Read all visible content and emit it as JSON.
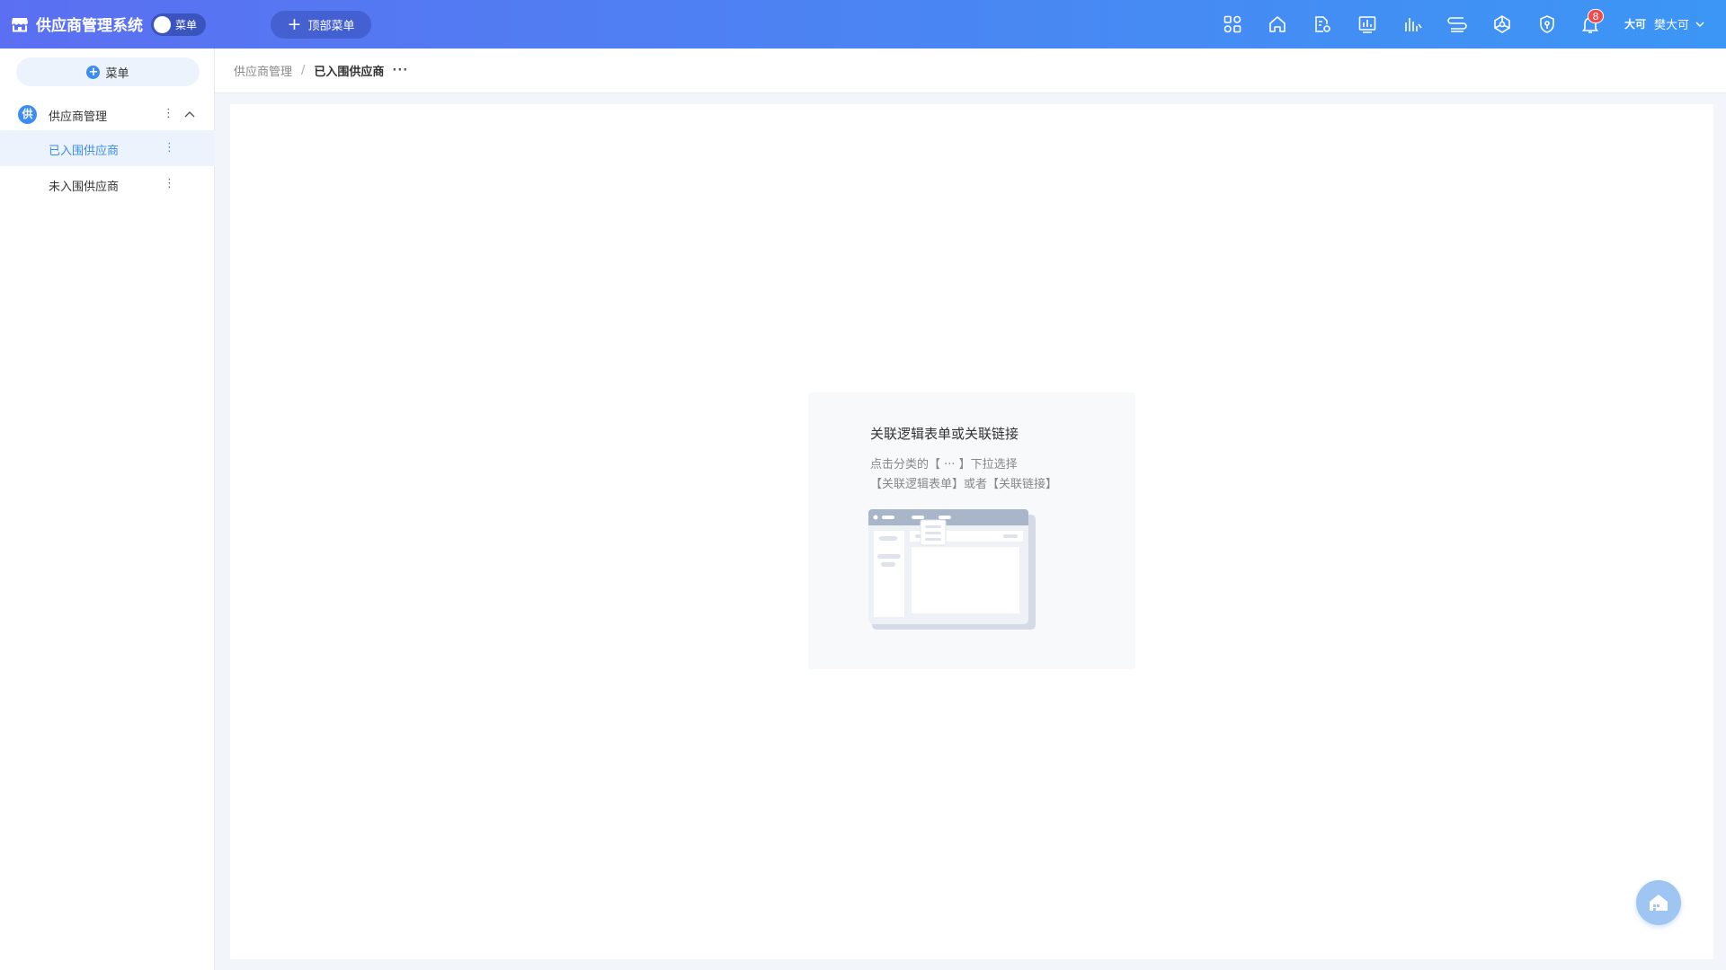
{
  "header": {
    "app_title": "供应商管理系统",
    "menu_toggle_label": "菜单",
    "top_menu_label": "顶部菜单",
    "notification_count": "8",
    "user_avatar_text": "大可",
    "user_name": "樊大可",
    "icons": [
      "apps-icon",
      "home-icon",
      "file-settings-icon",
      "dashboard-icon",
      "bar-chart-icon",
      "workflow-icon",
      "network-icon",
      "shield-icon",
      "bell-icon"
    ]
  },
  "sidebar": {
    "add_menu_label": "菜单",
    "group": {
      "icon_text": "供",
      "label": "供应商管理"
    },
    "items": [
      {
        "label": "已入围供应商",
        "active": true
      },
      {
        "label": "未入围供应商",
        "active": false
      }
    ]
  },
  "breadcrumb": {
    "parent": "供应商管理",
    "separator": "/",
    "current": "已入围供应商",
    "more": "···"
  },
  "main": {
    "empty_title": "关联逻辑表单或关联链接",
    "empty_desc_line1": "点击分类的【 ··· 】下拉选择",
    "empty_desc_line2": "【关联逻辑表单】或者【关联链接】"
  },
  "colors": {
    "header_gradient_start": "#5b6ff2",
    "header_gradient_end": "#3c96f5",
    "accent": "#3b8cf3",
    "active_bg": "#ecf3fd",
    "badge": "#f04b4b"
  }
}
